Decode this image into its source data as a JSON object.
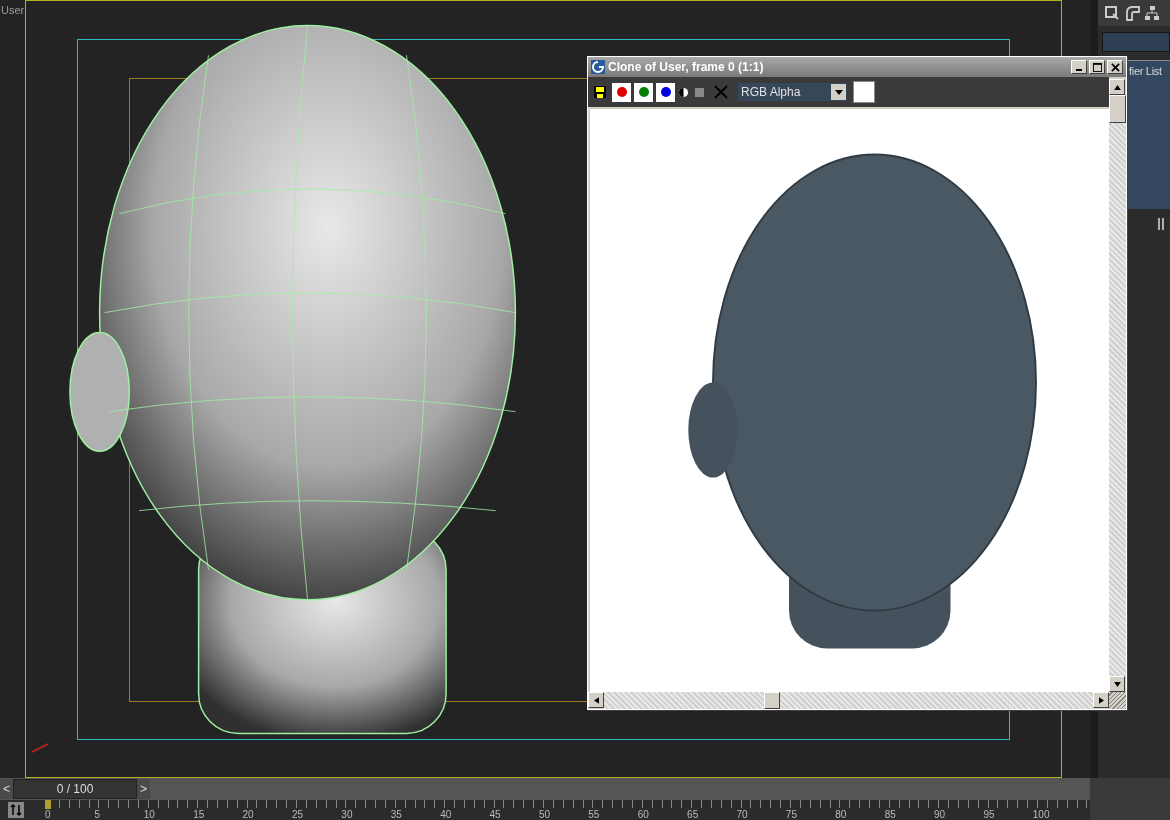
{
  "viewport": {
    "label": "User"
  },
  "render_window": {
    "title": "Clone of User, frame 0 (1:1)",
    "channels": [
      {
        "color": "#e00000",
        "selected": true
      },
      {
        "color": "#008000",
        "selected": true
      },
      {
        "color": "#0000e0",
        "selected": true
      }
    ],
    "channel_dropdown": {
      "value": "RGB Alpha"
    }
  },
  "command_panel": {
    "modifier_list": "fier List"
  },
  "time_slider": {
    "prev": "<",
    "value": "0 / 100",
    "level": 0,
    "next": ">"
  },
  "ruler": {
    "ticks": [
      "0",
      "5",
      "10",
      "15",
      "20",
      "25",
      "30",
      "35",
      "40",
      "45",
      "50",
      "55",
      "60",
      "65",
      "70",
      "75",
      "80",
      "85",
      "90",
      "95",
      "100"
    ]
  }
}
